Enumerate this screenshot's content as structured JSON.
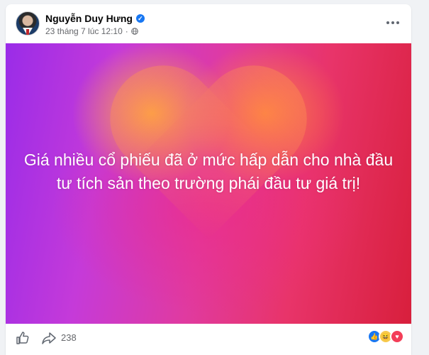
{
  "post": {
    "author_name": "Nguyễn Duy Hưng",
    "timestamp": "23 tháng 7 lúc 12:10",
    "separator": "·",
    "privacy_icon": "globe-icon",
    "verified_icon": "verified-badge-icon",
    "verified_mark": "✓",
    "text": "Giá nhiều cổ phiếu đã ở mức hấp dẫn cho nhà đầu tư tích sản theo trường phái đầu tư giá trị!",
    "share_count": "238",
    "reactions": [
      "like",
      "haha",
      "love"
    ],
    "reaction_glyphs": {
      "like": "👍",
      "haha": "😆",
      "love": "♥"
    }
  },
  "colors": {
    "accent": "#1877f2",
    "meta_text": "#65676b",
    "background_gradient": [
      "#9a2ce8",
      "#e03aa0",
      "#d81f3c"
    ]
  }
}
